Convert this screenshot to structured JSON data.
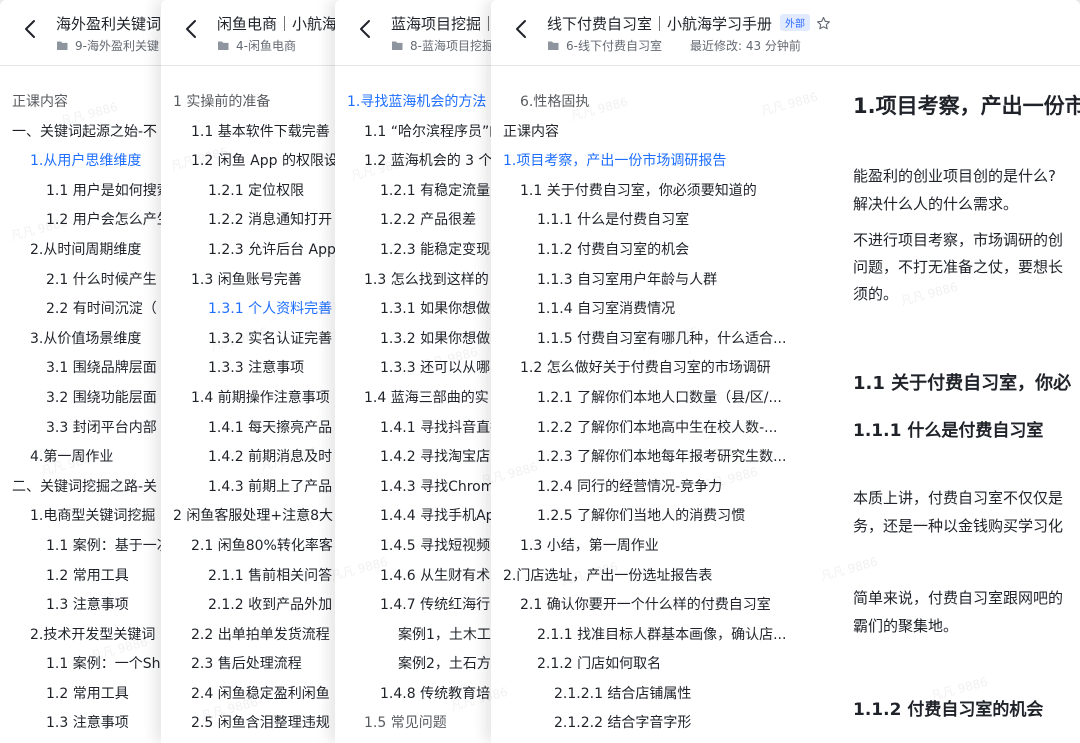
{
  "watermark": "凡凡 9886",
  "cards": [
    {
      "title": "海外盈利关键词",
      "path": "9-海外盈利关键",
      "toc": [
        {
          "label": "正课内容",
          "level": 0,
          "partial": true
        },
        {
          "label": "一、关键词起源之始-不",
          "level": 0
        },
        {
          "label": "1.从用户思维维度",
          "level": 1,
          "active": true
        },
        {
          "label": "1.1 用户是如何搜索",
          "level": 2
        },
        {
          "label": "1.2 用户会怎么产生",
          "level": 2
        },
        {
          "label": "2.从时间周期维度",
          "level": 1
        },
        {
          "label": "2.1 什么时候产生",
          "level": 2
        },
        {
          "label": "2.2 有时间沉淀（",
          "level": 2
        },
        {
          "label": "3.从价值场景维度",
          "level": 1
        },
        {
          "label": "3.1 围绕品牌层面",
          "level": 2
        },
        {
          "label": "3.2 围绕功能层面",
          "level": 2
        },
        {
          "label": "3.3 封闭平台内部",
          "level": 2
        },
        {
          "label": "4.第一周作业",
          "level": 1
        },
        {
          "label": "二、关键词挖掘之路-关",
          "level": 0
        },
        {
          "label": "1.电商型关键词挖掘",
          "level": 1
        },
        {
          "label": "1.1 案例：基于一次",
          "level": 2
        },
        {
          "label": "1.2 常用工具",
          "level": 2
        },
        {
          "label": "1.3 注意事项",
          "level": 2
        },
        {
          "label": "2.技术开发型关键词",
          "level": 1
        },
        {
          "label": "1.1 案例：一个Sh",
          "level": 2
        },
        {
          "label": "1.2 常用工具",
          "level": 2
        },
        {
          "label": "1.3 注意事项",
          "level": 2
        }
      ]
    },
    {
      "title": "闲鱼电商｜小航海",
      "path": "4-闲鱼电商",
      "toc": [
        {
          "label": "1 实操前的准备",
          "level": 0,
          "partial": true
        },
        {
          "label": "1.1 基本软件下载完善",
          "level": 1
        },
        {
          "label": "1.2 闲鱼 App 的权限设",
          "level": 1
        },
        {
          "label": "1.2.1 定位权限",
          "level": 2
        },
        {
          "label": "1.2.2 消息通知打开",
          "level": 2
        },
        {
          "label": "1.2.3 允许后台 App",
          "level": 2
        },
        {
          "label": "1.3 闲鱼账号完善",
          "level": 1
        },
        {
          "label": "1.3.1 个人资料完善",
          "level": 2,
          "active": true
        },
        {
          "label": "1.3.2 实名认证完善",
          "level": 2
        },
        {
          "label": "1.3.3 注意事项",
          "level": 2
        },
        {
          "label": "1.4 前期操作注意事项",
          "level": 1
        },
        {
          "label": "1.4.1 每天擦亮产品",
          "level": 2
        },
        {
          "label": "1.4.2 前期消息及时",
          "level": 2
        },
        {
          "label": "1.4.3 前期上了产品",
          "level": 2
        },
        {
          "label": "2 闲鱼客服处理+注意8大",
          "level": 0
        },
        {
          "label": "2.1 闲鱼80%转化率客",
          "level": 1
        },
        {
          "label": "2.1.1 售前相关问答",
          "level": 2
        },
        {
          "label": "2.1.2 收到产品外加",
          "level": 2
        },
        {
          "label": "2.2 出单拍单发货流程",
          "level": 1
        },
        {
          "label": "2.3 售后处理流程",
          "level": 1
        },
        {
          "label": "2.4 闲鱼稳定盈利闲鱼",
          "level": 1
        },
        {
          "label": "2.5 闲鱼含泪整理违规",
          "level": 1
        }
      ]
    },
    {
      "title": "蓝海项目挖掘｜",
      "path": "8-蓝海项目挖掘",
      "toc": [
        {
          "label": "1.寻找蓝海机会的方法",
          "level": 0,
          "active": true
        },
        {
          "label": "1.1 “哈尔滨程序员”的",
          "level": 1
        },
        {
          "label": "1.2 蓝海机会的 3 个",
          "level": 1
        },
        {
          "label": "1.2.1 有稳定流量",
          "level": 2
        },
        {
          "label": "1.2.2 产品很差",
          "level": 2
        },
        {
          "label": "1.2.3 能稳定变现",
          "level": 2
        },
        {
          "label": "1.3 怎么找到这样的",
          "level": 1
        },
        {
          "label": "1.3.1 如果你想做流",
          "level": 2
        },
        {
          "label": "1.3.2 如果你想做",
          "level": 2
        },
        {
          "label": "1.3.3 还可以从哪",
          "level": 2
        },
        {
          "label": "1.4 蓝海三部曲的实",
          "level": 1
        },
        {
          "label": "1.4.1 寻找抖音直播",
          "level": 2
        },
        {
          "label": "1.4.2 寻找淘宝店",
          "level": 2
        },
        {
          "label": "1.4.3 寻找Chrom",
          "level": 2
        },
        {
          "label": "1.4.4 寻找手机Ap",
          "level": 2
        },
        {
          "label": "1.4.5 寻找短视频",
          "level": 2
        },
        {
          "label": "1.4.6 从生财有术",
          "level": 2
        },
        {
          "label": "1.4.7 传统红海行",
          "level": 2
        },
        {
          "label": "案例1，土木工",
          "level": 3
        },
        {
          "label": "案例2，土石方",
          "level": 3
        },
        {
          "label": "1.4.8 传统教育培",
          "level": 2
        },
        {
          "label": "1.5 常见问题",
          "level": 1,
          "partial": true
        }
      ]
    },
    {
      "title": "线下付费自习室｜小航海学习手册",
      "badge": "外部",
      "path": "6-线下付费自习室",
      "modified": "最近修改: 43 分钟前",
      "toc": [
        {
          "label": "6.性格固执",
          "level": 1,
          "partial": true
        },
        {
          "label": "正课内容",
          "level": 0
        },
        {
          "label": "1.项目考察，产出一份市场调研报告",
          "level": 0,
          "active": true
        },
        {
          "label": "1.1 关于付费自习室，你必须要知道的",
          "level": 1
        },
        {
          "label": "1.1.1 什么是付费自习室",
          "level": 2
        },
        {
          "label": "1.1.2 付费自习室的机会",
          "level": 2
        },
        {
          "label": "1.1.3 自习室用户年龄与人群",
          "level": 2
        },
        {
          "label": "1.1.4 自习室消费情况",
          "level": 2
        },
        {
          "label": "1.1.5 付费自习室有哪几种，什么适合...",
          "level": 2
        },
        {
          "label": "1.2 怎么做好关于付费自习室的市场调研",
          "level": 1
        },
        {
          "label": "1.2.1 了解你们本地人口数量（县/区/...",
          "level": 2
        },
        {
          "label": "1.2.2 了解你们本地高中生在校人数-...",
          "level": 2
        },
        {
          "label": "1.2.3 了解你们本地每年报考研究生数...",
          "level": 2
        },
        {
          "label": "1.2.4 同行的经营情况-竞争力",
          "level": 2
        },
        {
          "label": "1.2.5 了解你们当地人的消费习惯",
          "level": 2
        },
        {
          "label": "1.3 小结，第一周作业",
          "level": 1
        },
        {
          "label": "2.门店选址，产出一份选址报告表",
          "level": 0
        },
        {
          "label": "2.1 确认你要开一个什么样的付费自习室",
          "level": 1
        },
        {
          "label": "2.1.1 找准目标人群基本画像，确认店...",
          "level": 2
        },
        {
          "label": "2.1.2 门店如何取名",
          "level": 2
        },
        {
          "label": "2.1.2.1 结合店铺属性",
          "level": 3
        },
        {
          "label": "2.1.2.2 结合字音字形",
          "level": 3
        }
      ],
      "content": {
        "h1": "1.项目考察，产出一份市",
        "p1_line1": "能盈利的创业项目创的是什么?",
        "p1_line2": "解决什么人的什么需求。",
        "p2_line1": "不进行项目考察，市场调研的创",
        "p2_line2": "问题，不打无准备之仗，要想长",
        "p2_line3": "须的。",
        "h2": "1.1 关于付费自习室，你必",
        "h3a": "1.1.1 什么是付费自习室",
        "p3_line1": "本质上讲，付费自习室不仅仅是",
        "p3_line2": "务，还是一种以金钱购买学习化",
        "p4_line1": "简单来说，付费自习室跟网吧的",
        "p4_line2": "霸们的聚集地。",
        "h3b": "1.1.2 付费自习室的机会"
      }
    }
  ]
}
